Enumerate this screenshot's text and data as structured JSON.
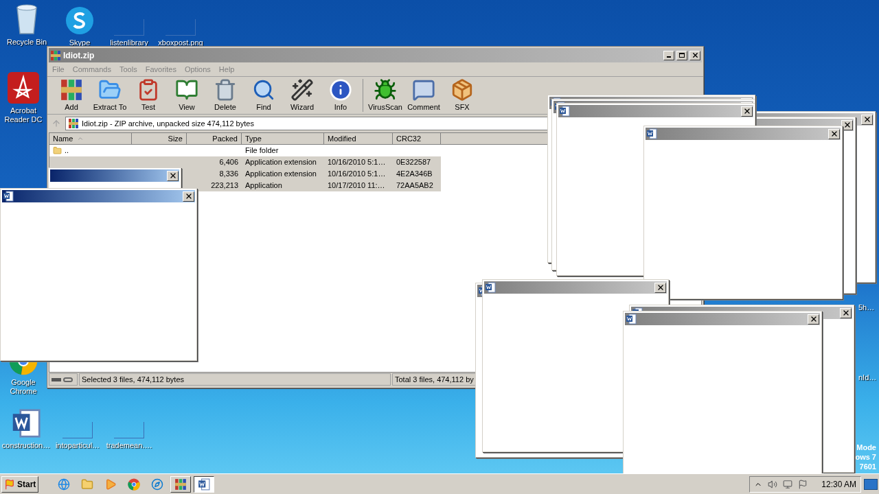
{
  "desktop_icons": [
    {
      "label": "Recycle Bin",
      "kind": "recycle"
    },
    {
      "label": "Skype",
      "kind": "skype"
    },
    {
      "label": "listenlibrary",
      "kind": "blank"
    },
    {
      "label": "xboxpost.png",
      "kind": "blank"
    },
    {
      "label": "Acrobat Reader DC",
      "kind": "acrobat"
    },
    {
      "label": "Google Chrome",
      "kind": "chrome"
    },
    {
      "label": "construction…",
      "kind": "word"
    },
    {
      "label": "intoparticul…",
      "kind": "blank"
    },
    {
      "label": "trademean….",
      "kind": "blank"
    }
  ],
  "desktop_edge_labels": [
    "5h…",
    "nId…"
  ],
  "test_mode_lines": [
    "Mode",
    "ows 7",
    "7601"
  ],
  "window": {
    "title": "Idiot.zip",
    "menu": [
      "File",
      "Commands",
      "Tools",
      "Favorites",
      "Options",
      "Help"
    ],
    "toolbar": [
      {
        "label": "Add"
      },
      {
        "label": "Extract To"
      },
      {
        "label": "Test"
      },
      {
        "label": "View"
      },
      {
        "label": "Delete"
      },
      {
        "label": "Find"
      },
      {
        "label": "Wizard"
      },
      {
        "label": "Info"
      },
      {
        "label": "VirusScan"
      },
      {
        "label": "Comment"
      },
      {
        "label": "SFX"
      }
    ],
    "address": "Idiot.zip - ZIP archive, unpacked size 474,112 bytes",
    "columns": [
      {
        "label": "Name",
        "sorted": true
      },
      {
        "label": "Size",
        "sorted": false
      },
      {
        "label": "Packed",
        "sorted": false
      },
      {
        "label": "Type",
        "sorted": false
      },
      {
        "label": "Modified",
        "sorted": false
      },
      {
        "label": "CRC32",
        "sorted": false
      }
    ],
    "rows": [
      {
        "name": "..",
        "type": "File folder",
        "selected": false
      },
      {
        "packed": "6,406",
        "type": "Application extension",
        "modified": "10/16/2010 5:1…",
        "crc32": "0E322587",
        "selected": true
      },
      {
        "packed": "8,336",
        "type": "Application extension",
        "modified": "10/16/2010 5:1…",
        "crc32": "4E2A346B",
        "selected": true
      },
      {
        "packed": "223,213",
        "type": "Application",
        "modified": "10/17/2010 11:…",
        "crc32": "72AA5AB2",
        "selected": true
      }
    ],
    "status_left": "Selected 3 files, 474,112 bytes",
    "status_right": "Total 3 files, 474,112 by"
  },
  "popups": [
    {
      "active": false
    },
    {
      "active": false
    },
    {
      "active": false
    },
    {
      "active": false
    },
    {
      "active": false
    },
    {
      "active": false
    },
    {
      "active": false
    },
    {
      "active": false
    },
    {
      "active": false
    },
    {
      "active": false
    },
    {
      "active": true
    },
    {
      "active": true
    }
  ],
  "taskbar": {
    "start": "Start",
    "apps": [
      {
        "kind": "ie",
        "selected": false
      },
      {
        "kind": "explorer",
        "selected": false
      },
      {
        "kind": "media",
        "selected": false
      },
      {
        "kind": "chrome",
        "selected": false
      },
      {
        "kind": "edge",
        "selected": false
      },
      {
        "kind": "winrar",
        "selected": false
      },
      {
        "kind": "word",
        "selected": true
      }
    ],
    "clock": "12:30 AM"
  }
}
